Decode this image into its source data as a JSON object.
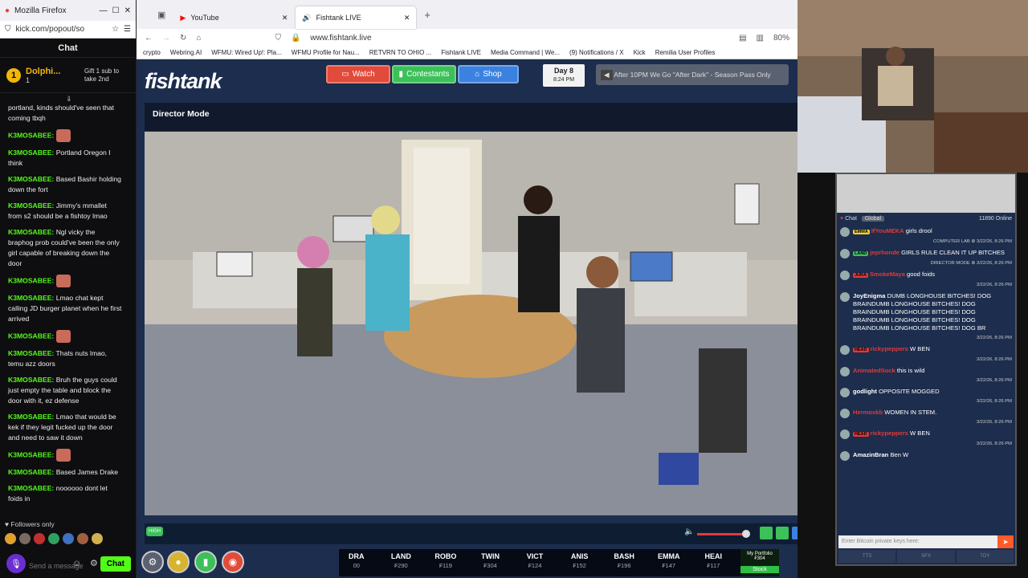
{
  "kick": {
    "window_title": "Mozilla Firefox",
    "url": "kick.com/popout/so",
    "chat_header": "Chat",
    "pinned_user": "Dolphi...",
    "pinned_count": "1",
    "gift_text": "Gift 1 sub to take 2nd",
    "messages": [
      {
        "user": "",
        "text": "portland, kinds should've seen that coming tbqh"
      },
      {
        "user": "K3MOSABEE:",
        "text": ""
      },
      {
        "user": "K3MOSABEE:",
        "text": "Portland Oregon I think"
      },
      {
        "user": "K3MOSABEE:",
        "text": "Based Bashir holding down the fort"
      },
      {
        "user": "K3MOSABEE:",
        "text": "Jimmy's mmallet from s2 should be a fishtoy lmao"
      },
      {
        "user": "K3MOSABEE:",
        "text": "Ngl vicky the braphog prob could've been the only girl capable of breaking down the door"
      },
      {
        "user": "K3MOSABEE:",
        "text": ""
      },
      {
        "user": "K3MOSABEE:",
        "text": "Lmao chat kept calling JD burger planet when he first arrived"
      },
      {
        "user": "K3MOSABEE:",
        "text": ""
      },
      {
        "user": "K3MOSABEE:",
        "text": "Thats nuts lmao, temu azz doors"
      },
      {
        "user": "K3MOSABEE:",
        "text": "Bruh the guys could just empty the table and block the door with it, ez defense"
      },
      {
        "user": "K3MOSABEE:",
        "text": "Lmao that would be kek if they legit fucked up the door and need to saw it down"
      },
      {
        "user": "K3MOSABEE:",
        "text": ""
      },
      {
        "user": "K3MOSABEE:",
        "text": "Based James Drake"
      },
      {
        "user": "K3MOSABEE:",
        "text": "noooooo dont let foids in"
      }
    ],
    "followers_only": "Followers only",
    "send_placeholder": "Send a message",
    "chat_button": "Chat"
  },
  "ff": {
    "tabs": [
      "YouTube",
      "Fishtank LIVE"
    ],
    "url": "www.fishtank.live",
    "zoom": "80%",
    "bookmarks": [
      "crypto",
      "Webring.AI",
      "WFMU: Wired Up!: Pla...",
      "WFMU Profile for Nau...",
      "RETVRN TO OHIO ...",
      "Fishtank LIVE",
      "Media Command | We...",
      "(9) Notifications / X",
      "Kick",
      "Remilia User Profiles"
    ]
  },
  "site": {
    "logo": "fishtank",
    "buttons": {
      "watch": "Watch",
      "contestants": "Contestants",
      "shop": "Shop"
    },
    "day": "Day 8",
    "time": "8:24 PM",
    "announcement": "After 10PM We Go \"After Dark\" - Season Pass Only",
    "mode": "Director Mode",
    "quality": "HIGH",
    "ticker": [
      {
        "name": "DRA",
        "val": "00"
      },
      {
        "name": "LAND",
        "val": "₣290"
      },
      {
        "name": "ROBO",
        "val": "₣119"
      },
      {
        "name": "TWIN",
        "val": "₣304"
      },
      {
        "name": "VICT",
        "val": "₣124"
      },
      {
        "name": "ANIS",
        "val": "₣152"
      },
      {
        "name": "BASH",
        "val": "₣196"
      },
      {
        "name": "EMMA",
        "val": "₣147"
      },
      {
        "name": "HEAI",
        "val": "₣117"
      }
    ],
    "portfolio": "My Portfolio",
    "portfolio_val": "₣304",
    "stock_btn": "Stock"
  },
  "rchat": {
    "tab": "Chat",
    "global": "Global",
    "online": "11890 Online",
    "messages": [
      {
        "tag": "EMMA",
        "name": "IfYouMEKA",
        "text": "girls drool",
        "meta": "COMPUTER LAB ⊕ 3/22/26, 8:26 PM"
      },
      {
        "tag": "LAND",
        "name": "jeprhonde",
        "text": "GIRLS RULE CLEAN IT UP BITCHES",
        "meta": "DIRECTOR MODE ⊕ 3/22/26, 8:26 PM"
      },
      {
        "tag": "JURA",
        "name": "SmokeMaya",
        "text": "good foids",
        "meta": "3/22/26, 8:26 PM"
      },
      {
        "tag": "",
        "name": "JoyEnigma",
        "text": "DUMB LONGHOUSE BITCHES! DOG BRAINDUMB LONGHOUSE BITCHES! DOG BRAINDUMB LONGHOUSE BITCHES! DOG BRAINDUMB LONGHOUSE BITCHES! DOG BRAINDUMB LONGHOUSE BITCHES! DOG BR",
        "meta": "3/22/26, 8:26 PM"
      },
      {
        "tag": "HEAD",
        "name": "rickypeppers",
        "text": "W BEN",
        "meta": "3/22/26, 8:26 PM"
      },
      {
        "tag": "",
        "name": "AnimatedSock",
        "text": "this is wild",
        "meta": "3/22/26, 8:26 PM"
      },
      {
        "tag": "",
        "name": "godlight",
        "text": "OPPOSITE MOGGED",
        "meta": "3/22/26, 8:26 PM"
      },
      {
        "tag": "",
        "name": "Hermoskb",
        "text": "WOMEN IN STEM.",
        "meta": "3/22/26, 8:26 PM"
      },
      {
        "tag": "HEAD",
        "name": "rickypeppers",
        "text": "W BEN",
        "meta": "3/22/26, 8:26 PM"
      },
      {
        "tag": "",
        "name": "AmazinBran",
        "text": "Ben W",
        "meta": ""
      }
    ],
    "input_placeholder": "Enter Bitcoin private keys here:",
    "btns": [
      "TTS",
      "SFX",
      "TOY"
    ]
  }
}
